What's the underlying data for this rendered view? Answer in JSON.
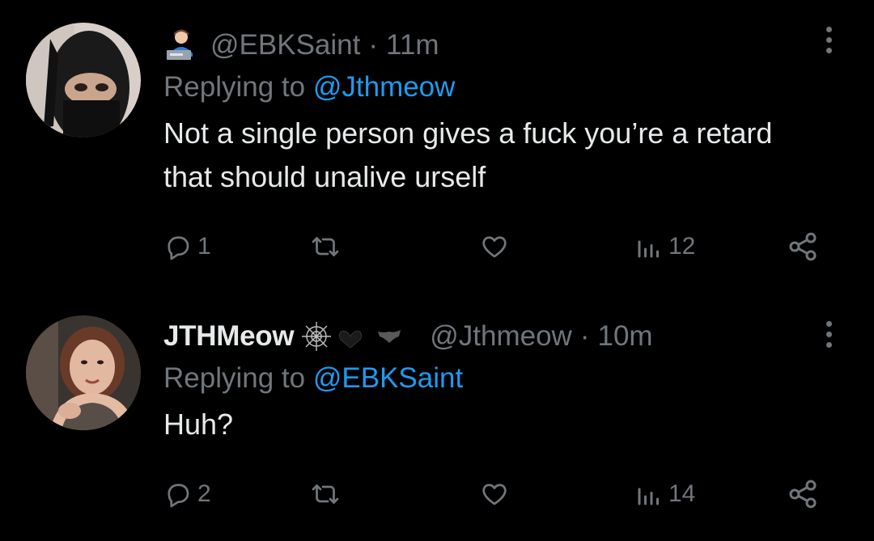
{
  "tweets": [
    {
      "handle": "@EBKSaint",
      "separator": "·",
      "time": "11m",
      "replying_prefix": "Replying to",
      "replying_to": "@Jthmeow",
      "text": "Not a single person gives a fuck you’re a retard that should unalive urself",
      "badge_emoji": "👩🏻‍💻",
      "actions": {
        "replies": "1",
        "retweets": "",
        "likes": "",
        "views": "12"
      }
    },
    {
      "display_name": "JTHMeow",
      "badge_emoji": "🕸️🖤🦇",
      "handle": "@Jthmeow",
      "separator": "·",
      "time": "10m",
      "replying_prefix": "Replying to",
      "replying_to": "@EBKSaint",
      "text": "Huh?",
      "actions": {
        "replies": "2",
        "retweets": "",
        "likes": "",
        "views": "14"
      }
    }
  ],
  "colors": {
    "background": "#000000",
    "text_primary": "#e7e9ea",
    "text_secondary": "#71767b",
    "link": "#1d9bf0"
  },
  "icons": {
    "reply": "reply-bubble-icon",
    "retweet": "retweet-icon",
    "like": "heart-icon",
    "views": "views-bar-chart-icon",
    "share": "share-nodes-icon",
    "more": "more-vertical-icon"
  }
}
